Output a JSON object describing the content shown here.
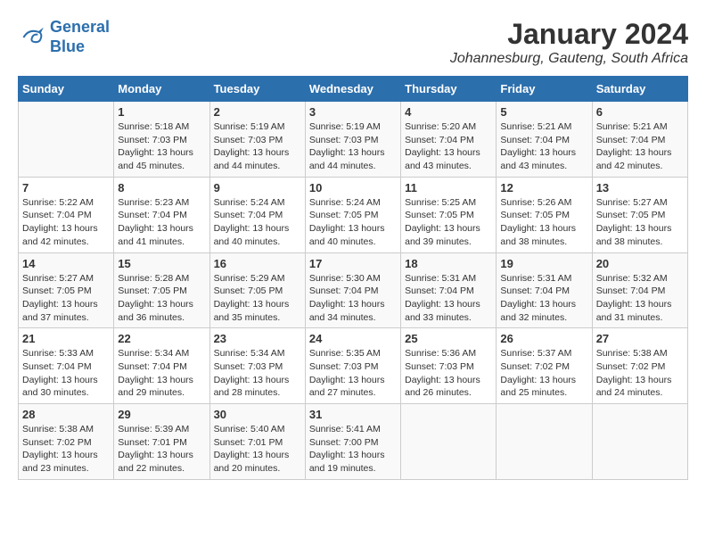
{
  "header": {
    "logo_line1": "General",
    "logo_line2": "Blue",
    "month": "January 2024",
    "location": "Johannesburg, Gauteng, South Africa"
  },
  "weekdays": [
    "Sunday",
    "Monday",
    "Tuesday",
    "Wednesday",
    "Thursday",
    "Friday",
    "Saturday"
  ],
  "weeks": [
    [
      {
        "day": "",
        "info": ""
      },
      {
        "day": "1",
        "info": "Sunrise: 5:18 AM\nSunset: 7:03 PM\nDaylight: 13 hours\nand 45 minutes."
      },
      {
        "day": "2",
        "info": "Sunrise: 5:19 AM\nSunset: 7:03 PM\nDaylight: 13 hours\nand 44 minutes."
      },
      {
        "day": "3",
        "info": "Sunrise: 5:19 AM\nSunset: 7:03 PM\nDaylight: 13 hours\nand 44 minutes."
      },
      {
        "day": "4",
        "info": "Sunrise: 5:20 AM\nSunset: 7:04 PM\nDaylight: 13 hours\nand 43 minutes."
      },
      {
        "day": "5",
        "info": "Sunrise: 5:21 AM\nSunset: 7:04 PM\nDaylight: 13 hours\nand 43 minutes."
      },
      {
        "day": "6",
        "info": "Sunrise: 5:21 AM\nSunset: 7:04 PM\nDaylight: 13 hours\nand 42 minutes."
      }
    ],
    [
      {
        "day": "7",
        "info": "Sunrise: 5:22 AM\nSunset: 7:04 PM\nDaylight: 13 hours\nand 42 minutes."
      },
      {
        "day": "8",
        "info": "Sunrise: 5:23 AM\nSunset: 7:04 PM\nDaylight: 13 hours\nand 41 minutes."
      },
      {
        "day": "9",
        "info": "Sunrise: 5:24 AM\nSunset: 7:04 PM\nDaylight: 13 hours\nand 40 minutes."
      },
      {
        "day": "10",
        "info": "Sunrise: 5:24 AM\nSunset: 7:05 PM\nDaylight: 13 hours\nand 40 minutes."
      },
      {
        "day": "11",
        "info": "Sunrise: 5:25 AM\nSunset: 7:05 PM\nDaylight: 13 hours\nand 39 minutes."
      },
      {
        "day": "12",
        "info": "Sunrise: 5:26 AM\nSunset: 7:05 PM\nDaylight: 13 hours\nand 38 minutes."
      },
      {
        "day": "13",
        "info": "Sunrise: 5:27 AM\nSunset: 7:05 PM\nDaylight: 13 hours\nand 38 minutes."
      }
    ],
    [
      {
        "day": "14",
        "info": "Sunrise: 5:27 AM\nSunset: 7:05 PM\nDaylight: 13 hours\nand 37 minutes."
      },
      {
        "day": "15",
        "info": "Sunrise: 5:28 AM\nSunset: 7:05 PM\nDaylight: 13 hours\nand 36 minutes."
      },
      {
        "day": "16",
        "info": "Sunrise: 5:29 AM\nSunset: 7:05 PM\nDaylight: 13 hours\nand 35 minutes."
      },
      {
        "day": "17",
        "info": "Sunrise: 5:30 AM\nSunset: 7:04 PM\nDaylight: 13 hours\nand 34 minutes."
      },
      {
        "day": "18",
        "info": "Sunrise: 5:31 AM\nSunset: 7:04 PM\nDaylight: 13 hours\nand 33 minutes."
      },
      {
        "day": "19",
        "info": "Sunrise: 5:31 AM\nSunset: 7:04 PM\nDaylight: 13 hours\nand 32 minutes."
      },
      {
        "day": "20",
        "info": "Sunrise: 5:32 AM\nSunset: 7:04 PM\nDaylight: 13 hours\nand 31 minutes."
      }
    ],
    [
      {
        "day": "21",
        "info": "Sunrise: 5:33 AM\nSunset: 7:04 PM\nDaylight: 13 hours\nand 30 minutes."
      },
      {
        "day": "22",
        "info": "Sunrise: 5:34 AM\nSunset: 7:04 PM\nDaylight: 13 hours\nand 29 minutes."
      },
      {
        "day": "23",
        "info": "Sunrise: 5:34 AM\nSunset: 7:03 PM\nDaylight: 13 hours\nand 28 minutes."
      },
      {
        "day": "24",
        "info": "Sunrise: 5:35 AM\nSunset: 7:03 PM\nDaylight: 13 hours\nand 27 minutes."
      },
      {
        "day": "25",
        "info": "Sunrise: 5:36 AM\nSunset: 7:03 PM\nDaylight: 13 hours\nand 26 minutes."
      },
      {
        "day": "26",
        "info": "Sunrise: 5:37 AM\nSunset: 7:02 PM\nDaylight: 13 hours\nand 25 minutes."
      },
      {
        "day": "27",
        "info": "Sunrise: 5:38 AM\nSunset: 7:02 PM\nDaylight: 13 hours\nand 24 minutes."
      }
    ],
    [
      {
        "day": "28",
        "info": "Sunrise: 5:38 AM\nSunset: 7:02 PM\nDaylight: 13 hours\nand 23 minutes."
      },
      {
        "day": "29",
        "info": "Sunrise: 5:39 AM\nSunset: 7:01 PM\nDaylight: 13 hours\nand 22 minutes."
      },
      {
        "day": "30",
        "info": "Sunrise: 5:40 AM\nSunset: 7:01 PM\nDaylight: 13 hours\nand 20 minutes."
      },
      {
        "day": "31",
        "info": "Sunrise: 5:41 AM\nSunset: 7:00 PM\nDaylight: 13 hours\nand 19 minutes."
      },
      {
        "day": "",
        "info": ""
      },
      {
        "day": "",
        "info": ""
      },
      {
        "day": "",
        "info": ""
      }
    ]
  ]
}
